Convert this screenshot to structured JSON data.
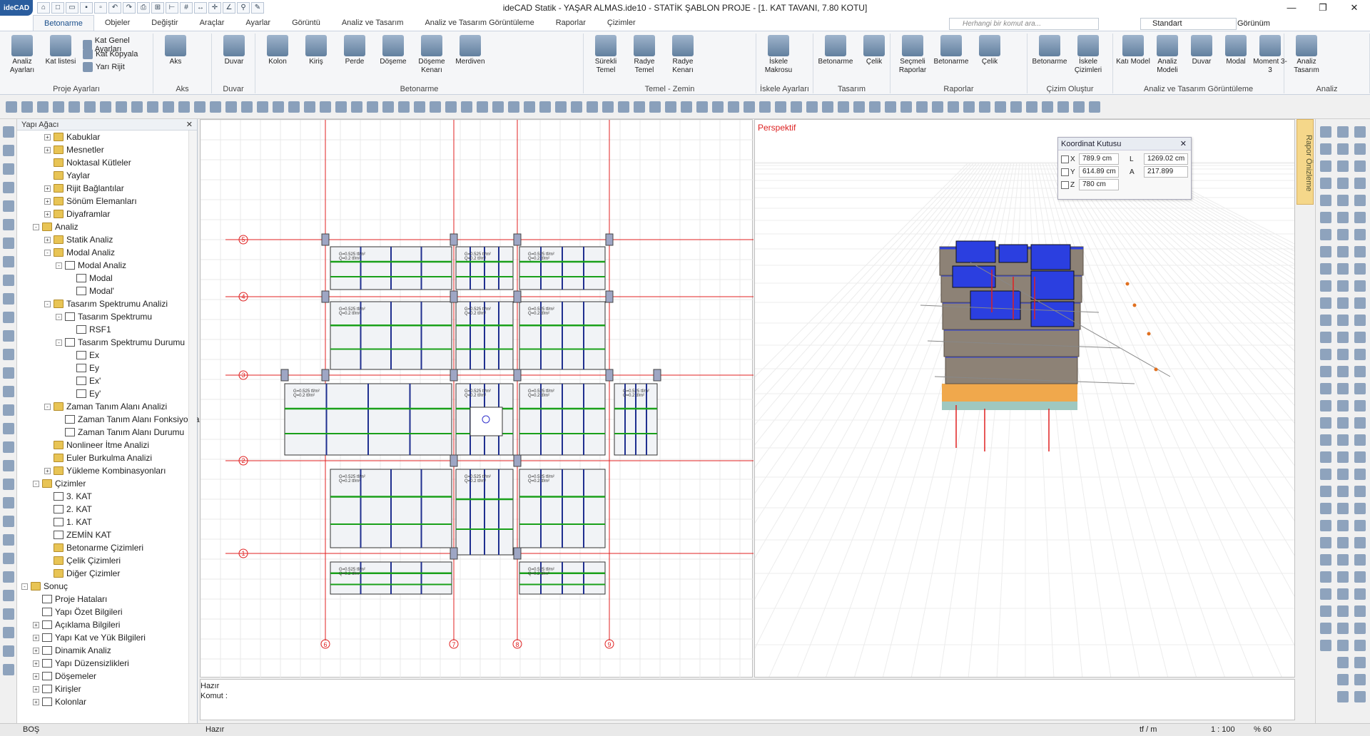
{
  "app": {
    "title": "ideCAD Statik - YAŞAR ALMAS.ide10 - STATİK ŞABLON PROJE - [1. KAT TAVANI,  7.80 KOTU]",
    "logo": "ideCAD"
  },
  "tabs": [
    "Betonarme",
    "Objeler",
    "Değiştir",
    "Araçlar",
    "Ayarlar",
    "Görüntü",
    "Analiz ve Tasarım",
    "Analiz ve Tasarım Görüntüleme",
    "Raporlar",
    "Çizimler"
  ],
  "search": {
    "placeholder": "Herhangi bir komut ara..."
  },
  "view_select": "Standart",
  "view_label": "Görünüm",
  "ribbon": {
    "groups": [
      {
        "label": "Proje Ayarları",
        "big": [
          "Analiz Ayarları",
          "Kat listesi"
        ],
        "small": [
          "Kat Genel Ayarları",
          "Kat Kopyala",
          "Yarı Rijit"
        ]
      },
      {
        "label": "Aks",
        "big": [
          "Aks"
        ]
      },
      {
        "label": "Duvar",
        "big": [
          "Duvar"
        ]
      },
      {
        "label": "Betonarme",
        "big": [
          "Kolon",
          "Kiriş",
          "Perde",
          "Döşeme",
          "Döşeme Kenarı",
          "Merdiven"
        ]
      },
      {
        "label": "Temel - Zemin",
        "big": [
          "Sürekli Temel",
          "Radye Temel",
          "Radye Kenarı"
        ]
      },
      {
        "label": "İskele Ayarları",
        "big": [
          "İskele Makrosu"
        ]
      },
      {
        "label": "Tasarım",
        "big": [
          "Betonarme",
          "Çelik"
        ]
      },
      {
        "label": "Raporlar",
        "big": [
          "Seçmeli Raporlar",
          "Betonarme",
          "Çelik"
        ]
      },
      {
        "label": "Çizim Oluştur",
        "big": [
          "Betonarme",
          "İskele Çizimleri"
        ]
      },
      {
        "label": "Analiz ve Tasarım Görüntüleme",
        "big": [
          "Katı Model",
          "Analiz Modeli",
          "Duvar",
          "Modal",
          "Moment 3-3"
        ]
      },
      {
        "label": "Analiz",
        "big": [
          "Analiz Tasarım"
        ]
      }
    ]
  },
  "tree": {
    "header": "Yapı Ağacı",
    "nodes": [
      {
        "label": "Kabuklar",
        "level": 2,
        "icon": "folder",
        "exp": "+"
      },
      {
        "label": "Mesnetler",
        "level": 2,
        "icon": "folder",
        "exp": "+"
      },
      {
        "label": "Noktasal Kütleler",
        "level": 2,
        "icon": "folder",
        "exp": ""
      },
      {
        "label": "Yaylar",
        "level": 2,
        "icon": "folder",
        "exp": ""
      },
      {
        "label": "Rijit Bağlantılar",
        "level": 2,
        "icon": "folder",
        "exp": "+"
      },
      {
        "label": "Sönüm Elemanları",
        "level": 2,
        "icon": "folder",
        "exp": "+"
      },
      {
        "label": "Diyaframlar",
        "level": 2,
        "icon": "folder",
        "exp": "+"
      },
      {
        "label": "Analiz",
        "level": 1,
        "icon": "folder",
        "exp": "-"
      },
      {
        "label": "Statik Analiz",
        "level": 2,
        "icon": "folder",
        "exp": "+"
      },
      {
        "label": "Modal Analiz",
        "level": 2,
        "icon": "folder",
        "exp": "-"
      },
      {
        "label": "Modal Analiz",
        "level": 3,
        "icon": "doc",
        "exp": "-"
      },
      {
        "label": "Modal",
        "level": 4,
        "icon": "doc",
        "exp": ""
      },
      {
        "label": "Modal'",
        "level": 4,
        "icon": "doc",
        "exp": ""
      },
      {
        "label": "Tasarım Spektrumu Analizi",
        "level": 2,
        "icon": "folder",
        "exp": "-"
      },
      {
        "label": "Tasarım Spektrumu",
        "level": 3,
        "icon": "doc",
        "exp": "-"
      },
      {
        "label": "RSF1",
        "level": 4,
        "icon": "doc",
        "exp": ""
      },
      {
        "label": "Tasarım Spektrumu Durumu",
        "level": 3,
        "icon": "doc",
        "exp": "-"
      },
      {
        "label": "Ex",
        "level": 4,
        "icon": "doc",
        "exp": ""
      },
      {
        "label": "Ey",
        "level": 4,
        "icon": "doc",
        "exp": ""
      },
      {
        "label": "Ex'",
        "level": 4,
        "icon": "doc",
        "exp": ""
      },
      {
        "label": "Ey'",
        "level": 4,
        "icon": "doc",
        "exp": ""
      },
      {
        "label": "Zaman Tanım Alanı Analizi",
        "level": 2,
        "icon": "folder",
        "exp": "-"
      },
      {
        "label": "Zaman Tanım Alanı Fonksiyonları",
        "level": 3,
        "icon": "doc",
        "exp": ""
      },
      {
        "label": "Zaman Tanım Alanı Durumu",
        "level": 3,
        "icon": "doc",
        "exp": ""
      },
      {
        "label": "Nonlineer İtme Analizi",
        "level": 2,
        "icon": "folder",
        "exp": ""
      },
      {
        "label": "Euler Burkulma Analizi",
        "level": 2,
        "icon": "folder",
        "exp": ""
      },
      {
        "label": "Yükleme Kombinasyonları",
        "level": 2,
        "icon": "folder",
        "exp": "+"
      },
      {
        "label": "Çizimler",
        "level": 1,
        "icon": "folder",
        "exp": "-"
      },
      {
        "label": "3. KAT",
        "level": 2,
        "icon": "doc",
        "exp": ""
      },
      {
        "label": "2. KAT",
        "level": 2,
        "icon": "doc",
        "exp": ""
      },
      {
        "label": "1. KAT",
        "level": 2,
        "icon": "doc",
        "exp": ""
      },
      {
        "label": "ZEMİN KAT",
        "level": 2,
        "icon": "doc",
        "exp": ""
      },
      {
        "label": "Betonarme Çizimleri",
        "level": 2,
        "icon": "folder",
        "exp": ""
      },
      {
        "label": "Çelik Çizimleri",
        "level": 2,
        "icon": "folder",
        "exp": ""
      },
      {
        "label": "Diğer Çizimler",
        "level": 2,
        "icon": "folder",
        "exp": ""
      },
      {
        "label": "Sonuç",
        "level": 0,
        "icon": "folder",
        "exp": "-"
      },
      {
        "label": "Proje Hataları",
        "level": 1,
        "icon": "doc",
        "exp": ""
      },
      {
        "label": "Yapı Özet Bilgileri",
        "level": 1,
        "icon": "doc",
        "exp": ""
      },
      {
        "label": "Açıklama Bilgileri",
        "level": 1,
        "icon": "doc",
        "exp": "+"
      },
      {
        "label": "Yapı Kat ve Yük Bilgileri",
        "level": 1,
        "icon": "doc",
        "exp": "+"
      },
      {
        "label": "Dinamik Analiz",
        "level": 1,
        "icon": "doc",
        "exp": "+"
      },
      {
        "label": "Yapı Düzensizlikleri",
        "level": 1,
        "icon": "doc",
        "exp": "+"
      },
      {
        "label": "Döşemeler",
        "level": 1,
        "icon": "doc",
        "exp": "+"
      },
      {
        "label": "Kirişler",
        "level": 1,
        "icon": "doc",
        "exp": "+"
      },
      {
        "label": "Kolonlar",
        "level": 1,
        "icon": "doc",
        "exp": "+"
      }
    ]
  },
  "plan": {
    "axes_x": [
      "6",
      "7",
      "8",
      "9"
    ],
    "axes_y": [
      "5",
      "4",
      "3",
      "2",
      "1"
    ],
    "slab_load": "G=0.525 tf/m²",
    "slab_live": "Q=0.2 tf/m²",
    "slab_live2": "Q=0.5 tf/m²"
  },
  "perspective": {
    "label": "Perspektif"
  },
  "coord_box": {
    "title": "Koordinat Kutusu",
    "x_label": "X",
    "x": "789.9 cm",
    "y_label": "Y",
    "y": "614.89 cm",
    "z_label": "Z",
    "z": "780 cm",
    "l_label": "L",
    "l": "1269.02 cm",
    "a_label": "A",
    "a": "217.899"
  },
  "side_tab": "Rapor Önizleme",
  "command": {
    "line1": "Hazır",
    "line2": "Komut :"
  },
  "status": {
    "left": "BOŞ",
    "mid": "Hazır",
    "unit": "tf / m",
    "scale": "1 : 100",
    "zoom": "% 60"
  },
  "colors": {
    "accent": "#1a4f8b",
    "axis": "#e02020",
    "beam": "#1f2f8f",
    "rebar": "#1aa01a",
    "slab3d": "#2b3fe0"
  }
}
